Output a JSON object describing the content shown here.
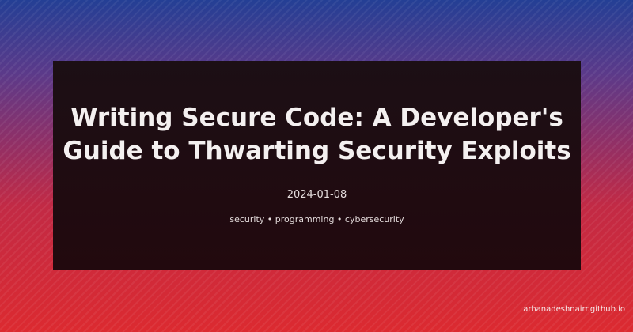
{
  "post": {
    "title": "Writing Secure Code: A Developer's Guide to Thwarting Security Exploits",
    "date": "2024-01-08",
    "tags": "security • programming • cybersecurity"
  },
  "site": {
    "domain": "arhanadeshnairr.github.io"
  },
  "colors": {
    "gradient_top": "#243f95",
    "gradient_bottom": "#dc2a30",
    "card_background": "#1c0f15",
    "text": "#f4f0f0"
  }
}
